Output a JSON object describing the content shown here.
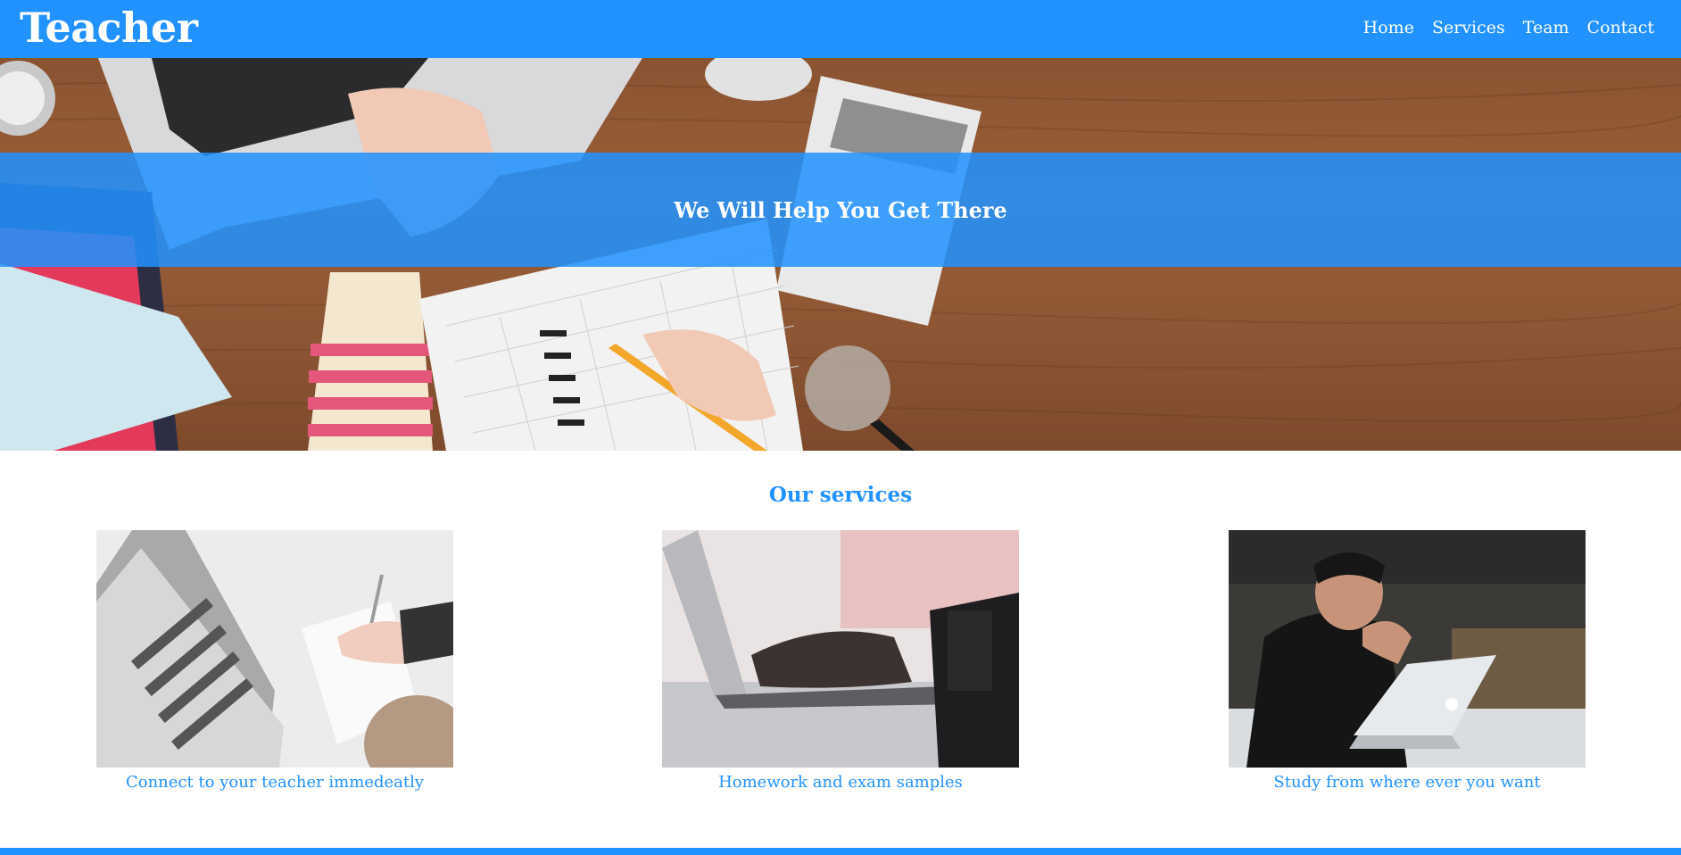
{
  "header": {
    "brand": "Teacher",
    "nav": [
      {
        "label": "Home"
      },
      {
        "label": "Services"
      },
      {
        "label": "Team"
      },
      {
        "label": "Contact"
      }
    ]
  },
  "hero": {
    "tagline": "We Will Help You Get There"
  },
  "services": {
    "title": "Our services",
    "items": [
      {
        "caption": "Connect to your teacher immedeatly"
      },
      {
        "caption": "Homework and exam samples"
      },
      {
        "caption": "Study from where ever you want"
      }
    ]
  },
  "colors": {
    "brand_blue": "#2192ff",
    "text_on_brand": "#ffffff"
  }
}
